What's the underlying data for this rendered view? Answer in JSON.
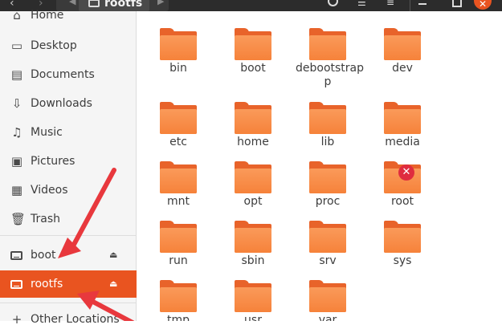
{
  "header": {
    "back_icon": "‹",
    "forward_icon": "›",
    "path_left_arrow": "◀",
    "path_label": "rootfs",
    "path_right_arrow": "▶",
    "close_glyph": "✕"
  },
  "sidebar": {
    "items": [
      {
        "label": "Home",
        "icon": "home-icon"
      },
      {
        "label": "Desktop",
        "icon": "desktop-icon"
      },
      {
        "label": "Documents",
        "icon": "documents-icon"
      },
      {
        "label": "Downloads",
        "icon": "downloads-icon"
      },
      {
        "label": "Music",
        "icon": "music-icon"
      },
      {
        "label": "Pictures",
        "icon": "pictures-icon"
      },
      {
        "label": "Videos",
        "icon": "videos-icon"
      },
      {
        "label": "Trash",
        "icon": "trash-icon"
      }
    ],
    "drives": [
      {
        "label": "boot",
        "eject": "⏏"
      },
      {
        "label": "rootfs",
        "eject": "⏏"
      }
    ],
    "other_locations": "Other Locations",
    "other_icon": "+"
  },
  "folders": [
    {
      "name": "bin"
    },
    {
      "name": "boot"
    },
    {
      "name": "debootstrap",
      "name_line2": "p"
    },
    {
      "name": "dev"
    },
    {
      "name": "etc"
    },
    {
      "name": "home"
    },
    {
      "name": "lib"
    },
    {
      "name": "media"
    },
    {
      "name": "mnt"
    },
    {
      "name": "opt"
    },
    {
      "name": "proc"
    },
    {
      "name": "root",
      "badge": "✕"
    },
    {
      "name": "run"
    },
    {
      "name": "sbin"
    },
    {
      "name": "srv"
    },
    {
      "name": "sys"
    },
    {
      "name": "tmp"
    },
    {
      "name": "usr"
    },
    {
      "name": "var"
    }
  ],
  "colors": {
    "accent": "#e95420",
    "folder": "#f6823a",
    "annotation_arrow": "#e8383d"
  }
}
